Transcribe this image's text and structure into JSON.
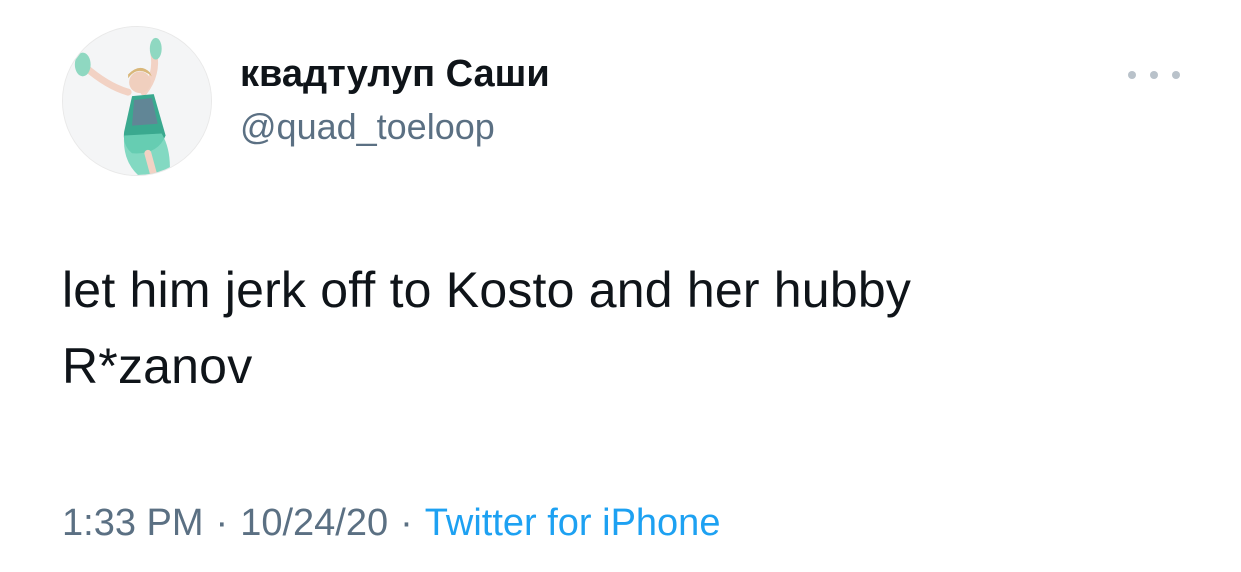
{
  "tweet": {
    "display_name": "квадтулуп Саши",
    "handle": "@quad_toeloop",
    "text_line1": "let him jerk off to Kosto and her hubby",
    "text_line2": "R*zanov",
    "time": "1:33 PM",
    "date": "10/24/20",
    "separator": "·",
    "source": "Twitter for iPhone"
  },
  "icons": {
    "more": "more-horizontal-icon"
  },
  "colors": {
    "text": "#0f1419",
    "secondary": "#5b7083",
    "link": "#1da1f2",
    "more_dots": "#b9c2ca"
  }
}
